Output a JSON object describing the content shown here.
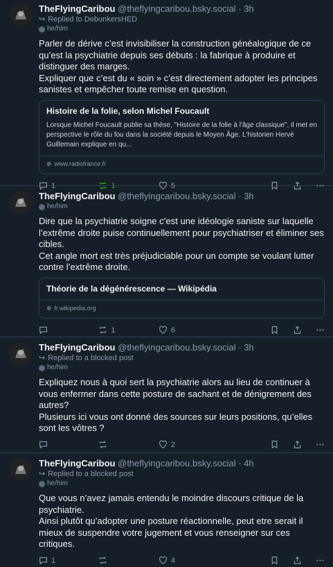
{
  "posts": [
    {
      "name": "TheFlyingCaribou",
      "handle": "@theflyingcaribou.bsky.social",
      "time": "3h",
      "reply_label": "Replied to DebunkersHED",
      "pronouns": "he/him",
      "text": "Parler de dérive c’est invisibiliser la construction généalogique de ce qu’est la psychiatrie depuis ses débuts : la fabrique à produire et distinguer des marges.\nExpliquer que c’est du « soin » c’est directement adopter les principes sanistes et empêcher toute remise en question.",
      "card": {
        "title": "Histoire de la folie, selon Michel Foucault",
        "description": "Lorsque Michel Foucault publie sa thèse, \"Histoire de la folie à l'âge classique\", il met en perspective le rôle du fou dans la société depuis le Moyen Âge. L'historien Hervé Guillemain explique en qu...",
        "domain": "www.radiofrance.fr"
      },
      "replies": "1",
      "reposts": "1",
      "likes": "5",
      "repost_active": true
    },
    {
      "name": "TheFlyingCaribou",
      "handle": "@theflyingcaribou.bsky.social",
      "time": "3h",
      "reply_label": "",
      "pronouns": "he/him",
      "text": "Dire que la psychiatrie soigne c’est une idéologie saniste sur laquelle l’extrême droite puise continuellement pour psychiatriser et éliminer ses cibles.\nCet angle mort est très préjudiciable pour un compte se voulant lutter contre l’extrême droite.",
      "card": {
        "title": "Théorie de la dégénérescence — Wikipédia",
        "description": "",
        "domain": "fr.wikipedia.org"
      },
      "replies": "",
      "reposts": "1",
      "likes": "6",
      "repost_active": false
    },
    {
      "name": "TheFlyingCaribou",
      "handle": "@theflyingcaribou.bsky.social",
      "time": "3h",
      "reply_label": "Replied to a blocked post",
      "pronouns": "he/him",
      "text": "Expliquez nous à quoi sert la psychiatrie alors au lieu de continuer à vous enfermer dans cette posture de sachant et de dénigrement des autres?\nPlusieurs ici vous ont donné des sources sur leurs positions, qu’elles sont les vôtres ?",
      "card": null,
      "replies": "",
      "reposts": "",
      "likes": "2",
      "repost_active": false
    },
    {
      "name": "TheFlyingCaribou",
      "handle": "@theflyingcaribou.bsky.social",
      "time": "4h",
      "reply_label": "Replied to a blocked post",
      "pronouns": "he/him",
      "text": "Que vous n’avez jamais entendu le moindre discours critique de la psychiatrie.\nAinsi plutôt qu’adopter une posture réactionnelle, peut etre serait il mieux de suspendre votre jugement et vous renseigner sur ces critiques.",
      "card": null,
      "replies": "1",
      "reposts": "",
      "likes": "4",
      "repost_active": false
    }
  ],
  "colors": {
    "background": "#161e27",
    "text": "#f1f3f5",
    "muted": "#8c9aab",
    "border": "#2e4052",
    "repost_active": "#20bc07"
  }
}
